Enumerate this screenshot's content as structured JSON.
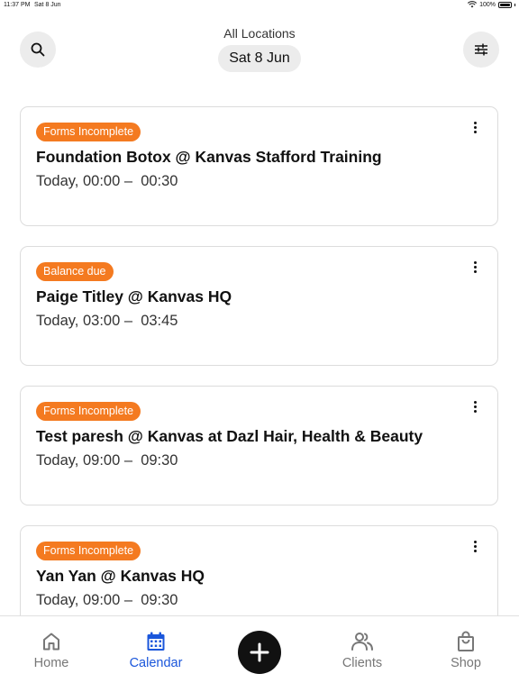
{
  "status_bar": {
    "time": "11:37 PM",
    "date": "Sat 8 Jun",
    "battery": "100%"
  },
  "header": {
    "location": "All Locations",
    "date": "Sat 8 Jun",
    "search_icon": "search-icon",
    "filter_icon": "sliders-icon"
  },
  "appointments": [
    {
      "badge": "Forms Incomplete",
      "title": "Foundation Botox @ Kanvas Stafford Training",
      "time": "Today, 00:00 –  00:30"
    },
    {
      "badge": "Balance due",
      "title": "Paige  Titley @ Kanvas HQ",
      "time": "Today, 03:00 –  03:45"
    },
    {
      "badge": "Forms Incomplete",
      "title": "Test paresh @ Kanvas at Dazl Hair, Health & Beauty",
      "time": "Today, 09:00 –  09:30"
    },
    {
      "badge": "Forms Incomplete",
      "title": "Yan Yan @ Kanvas HQ",
      "time": "Today, 09:00 –  09:30"
    }
  ],
  "tab_bar": {
    "home": "Home",
    "calendar": "Calendar",
    "clients": "Clients",
    "shop": "Shop",
    "active": "calendar"
  },
  "colors": {
    "badge": "#f47a20",
    "active_tab": "#1a56db",
    "add_button": "#111111"
  }
}
